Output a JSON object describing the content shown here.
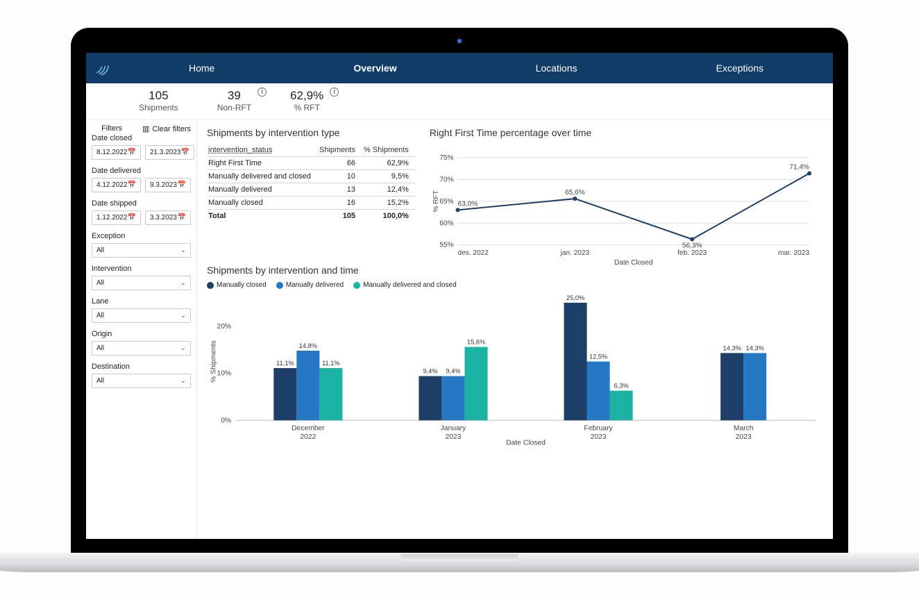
{
  "nav": {
    "items": [
      "Home",
      "Overview",
      "Locations",
      "Exceptions"
    ],
    "active": "Overview"
  },
  "kpis": {
    "shipments": {
      "value": "105",
      "label": "Shipments"
    },
    "nonrft": {
      "value": "39",
      "label": "Non-RFT"
    },
    "pctrft": {
      "value": "62,9%",
      "label": "% RFT"
    }
  },
  "filters": {
    "heading": "Filters",
    "clear_label": "Clear filters",
    "date_closed": {
      "label": "Date closed",
      "from": "8.12.2022",
      "to": "21.3.2023"
    },
    "date_delivered": {
      "label": "Date delivered",
      "from": "4.12.2022",
      "to": "9.3.2023"
    },
    "date_shipped": {
      "label": "Date shipped",
      "from": "1.12.2022",
      "to": "3.3.2023"
    },
    "exception": {
      "label": "Exception",
      "value": "All"
    },
    "intervention": {
      "label": "Intervention",
      "value": "All"
    },
    "lane": {
      "label": "Lane",
      "value": "All"
    },
    "origin": {
      "label": "Origin",
      "value": "All"
    },
    "destination": {
      "label": "Destination",
      "value": "All"
    }
  },
  "table": {
    "title": "Shipments by intervention type",
    "cols": [
      "intervention_status",
      "Shipments",
      "% Shipments"
    ],
    "rows": [
      {
        "name": "Right First Time",
        "shipments": "66",
        "pct": "62,9%"
      },
      {
        "name": "Manually delivered and closed",
        "shipments": "10",
        "pct": "9,5%"
      },
      {
        "name": "Manually delivered",
        "shipments": "13",
        "pct": "12,4%"
      },
      {
        "name": "Manually closed",
        "shipments": "16",
        "pct": "15,2%"
      }
    ],
    "total": {
      "name": "Total",
      "shipments": "105",
      "pct": "100,0%"
    }
  },
  "line_panel": {
    "title": "Right First Time percentage over time",
    "ylabel": "% RFT",
    "xlabel": "Date Closed"
  },
  "bar_panel": {
    "title": "Shipments by intervention and time",
    "legend": [
      "Manually closed",
      "Manually delivered",
      "Manually delivered and closed"
    ],
    "ylabel": "% Shipments",
    "xlabel": "Date Closed"
  },
  "colors": {
    "nav_bg": "#123c68",
    "series1": "#1d3f68",
    "series2": "#2678c4",
    "series3": "#1bb3a4"
  },
  "chart_data": [
    {
      "type": "line",
      "title": "Right First Time percentage over time",
      "x": [
        "des. 2022",
        "jan. 2023",
        "feb. 2023",
        "mar. 2023"
      ],
      "values": [
        63.0,
        65.6,
        56.3,
        71.4
      ],
      "value_labels": [
        "63,0%",
        "65,6%",
        "56,3%",
        "71,4%"
      ],
      "ylim": [
        55,
        75
      ],
      "yticks": [
        55,
        60,
        65,
        70,
        75
      ],
      "ylabel": "% RFT",
      "xlabel": "Date Closed",
      "grid": true
    },
    {
      "type": "bar",
      "title": "Shipments by intervention and time",
      "categories": [
        "December 2022",
        "January 2023",
        "February 2023",
        "March 2023"
      ],
      "series": [
        {
          "name": "Manually closed",
          "values": [
            11.1,
            9.4,
            25.0,
            14.3
          ],
          "labels": [
            "11,1%",
            "9,4%",
            "25,0%",
            "14,3%"
          ],
          "color": "#1d3f68"
        },
        {
          "name": "Manually delivered",
          "values": [
            14.8,
            9.4,
            12.5,
            14.3
          ],
          "labels": [
            "14,8%",
            "9,4%",
            "12,5%",
            "14,3%"
          ],
          "color": "#2678c4"
        },
        {
          "name": "Manually delivered and closed",
          "values": [
            11.1,
            15.6,
            6.3,
            null
          ],
          "labels": [
            "11,1%",
            "15,6%",
            "6,3%",
            ""
          ],
          "color": "#1bb3a4"
        }
      ],
      "ylim": [
        0,
        20
      ],
      "yticks": [
        0,
        10,
        20
      ],
      "ylabel": "% Shipments",
      "xlabel": "Date Closed",
      "legend_position": "top-left"
    }
  ]
}
